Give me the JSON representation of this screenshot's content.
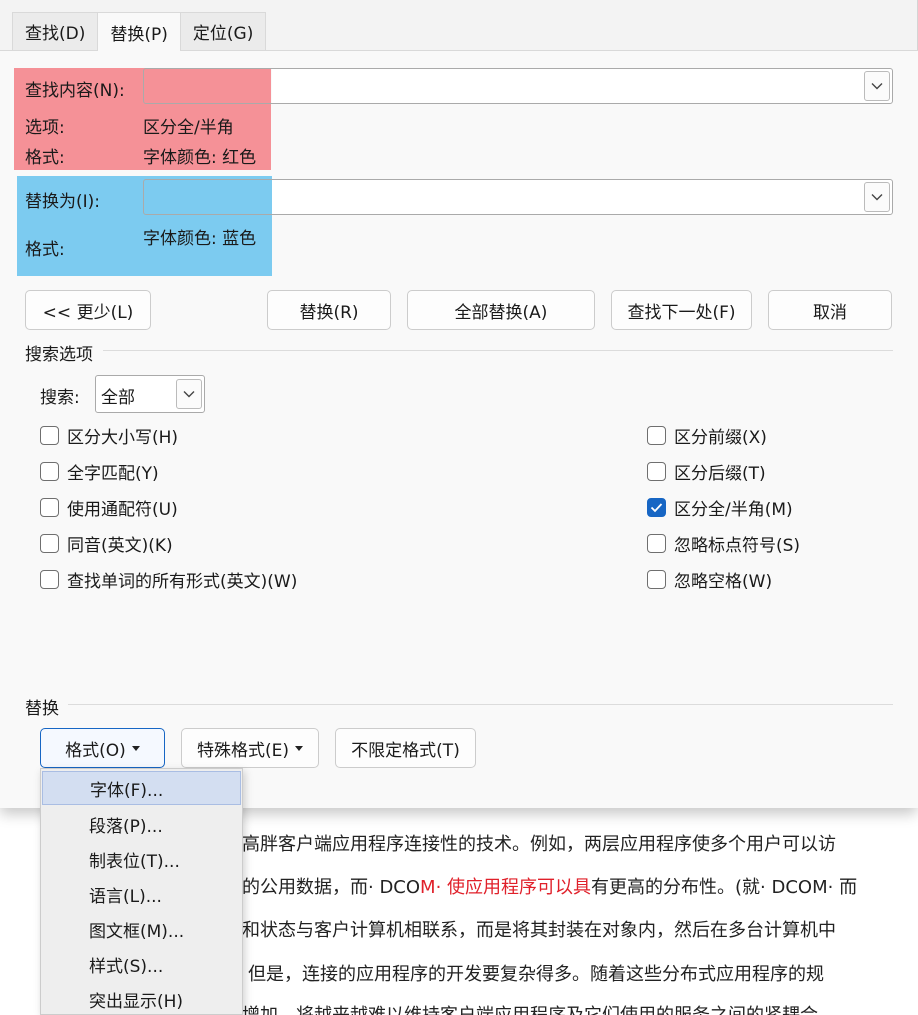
{
  "tabs": [
    {
      "label": "查找(D)",
      "key": "D",
      "active": false
    },
    {
      "label": "替换(P)",
      "key": "P",
      "active": true
    },
    {
      "label": "定位(G)",
      "key": "G",
      "active": false
    }
  ],
  "find": {
    "label": "查找内容(N):",
    "value": "",
    "options_label": "选项:",
    "options_value": "区分全/半角",
    "format_label": "格式:",
    "format_value": "字体颜色: 红色"
  },
  "replace": {
    "label": "替换为(I):",
    "value": "",
    "format_label": "格式:",
    "format_value": "字体颜色: 蓝色"
  },
  "buttons": {
    "less": "<< 更少(L)",
    "replace": "替换(R)",
    "replace_all": "全部替换(A)",
    "find_next": "查找下一处(F)",
    "cancel": "取消"
  },
  "search_options": {
    "title": "搜索选项",
    "search_label": "搜索:",
    "search_value": "全部",
    "left_checks": [
      {
        "label": "区分大小写(H)",
        "checked": false
      },
      {
        "label": "全字匹配(Y)",
        "checked": false
      },
      {
        "label": "使用通配符(U)",
        "checked": false
      },
      {
        "label": "同音(英文)(K)",
        "checked": false
      },
      {
        "label": "查找单词的所有形式(英文)(W)",
        "checked": false
      }
    ],
    "right_checks": [
      {
        "label": "区分前缀(X)",
        "checked": false
      },
      {
        "label": "区分后缀(T)",
        "checked": false
      },
      {
        "label": "区分全/半角(M)",
        "checked": true
      },
      {
        "label": "忽略标点符号(S)",
        "checked": false
      },
      {
        "label": "忽略空格(W)",
        "checked": false
      }
    ]
  },
  "replace_section": {
    "title": "替换",
    "format_button": "格式(O)",
    "special_button": "特殊格式(E)",
    "no_format_button": "不限定格式(T)"
  },
  "format_menu": {
    "items": [
      "字体(F)...",
      "段落(P)...",
      "制表位(T)...",
      "语言(L)...",
      "图文框(M)...",
      "样式(S)...",
      "突出显示(H)"
    ],
    "highlighted_index": 0
  },
  "document": {
    "lines": [
      {
        "a": "高胖客户端应用程序连接性的技术。例如，两层应用程序使多个用户可以访",
        "red": "",
        "b": ""
      },
      {
        "a": "的公用数据，而· DCO",
        "red": "M· 使应用程序可以具",
        "b": "有更高的分布性。(就· DCOM· 而"
      },
      {
        "a": "和状态与客户计算机相联系，而是将其封装在对象内，然后在多台计算机中",
        "red": "",
        "b": ""
      },
      {
        "a": "但是，连接的应用程序的开发要复杂得多。随着这些分布式应用程序的规",
        "red": "",
        "b": ""
      },
      {
        "a": "增加，将越来越难以维持客户端应用程序及它们使用的服务之间的紧耦合",
        "red": "",
        "b": ""
      }
    ]
  },
  "colors": {
    "accent": "#1766c4",
    "find_highlight": "#f36e76",
    "replace_highlight": "#4bb9ec",
    "red_text": "#e0202a"
  }
}
